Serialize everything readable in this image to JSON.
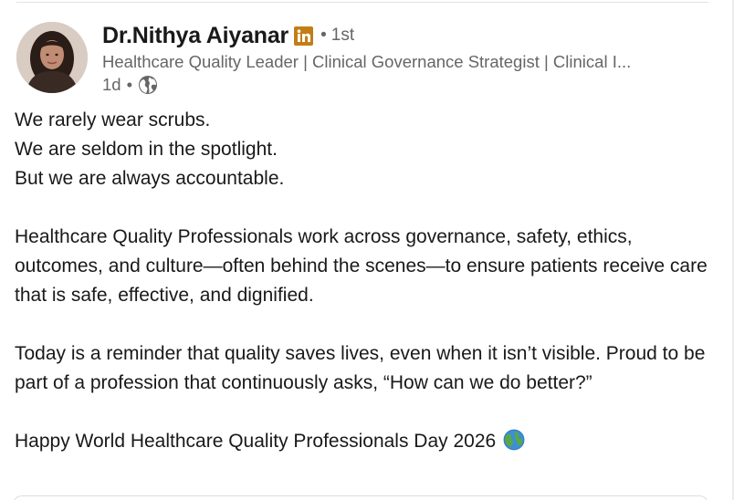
{
  "author": {
    "name": "Dr.Nithya Aiyanar",
    "degree": "1st",
    "headline": "Healthcare Quality Leader | Clinical Governance Strategist | Clinical I...",
    "time_ago": "1d",
    "visibility_icon": "globe-icon",
    "badge_icon": "linkedin-icon"
  },
  "post": {
    "lines": [
      "We rarely wear scrubs.",
      "We are seldom in the spotlight.",
      "But we are always accountable."
    ],
    "paragraph2": "Healthcare Quality Professionals work across governance, safety, ethics, outcomes, and culture—often behind the scenes—to ensure patients receive care that is safe, effective, and dignified.",
    "paragraph3": "Today is a reminder that quality saves lives, even when it isn’t visible. Proud to be part of a profession that continuously asks, “How can we do better?”",
    "paragraph4": "Happy World Healthcare Quality Professionals Day 2026",
    "paragraph4_emoji": "earth-globe-emoji"
  },
  "colors": {
    "linkedin_badge": "#c37d16",
    "text_primary": "#191919",
    "text_secondary": "#666666"
  }
}
